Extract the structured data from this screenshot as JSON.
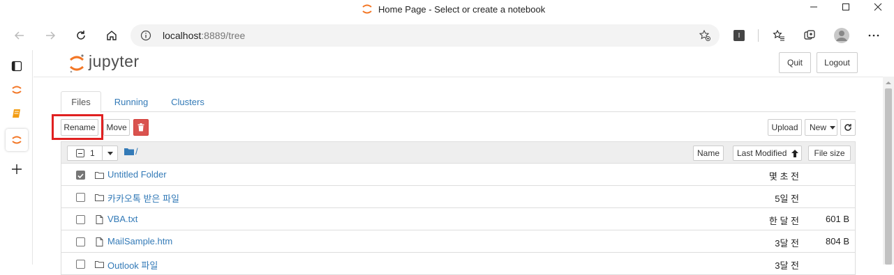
{
  "window": {
    "title": "Home Page - Select or create a notebook"
  },
  "browser": {
    "url_host": "localhost",
    "url_rest": ":8889/tree"
  },
  "jupyter": {
    "logo_text": "jupyter",
    "quit_label": "Quit",
    "logout_label": "Logout",
    "tabs": [
      {
        "label": "Files",
        "active": true
      },
      {
        "label": "Running",
        "active": false
      },
      {
        "label": "Clusters",
        "active": false
      }
    ],
    "toolbar": {
      "rename_label": "Rename",
      "move_label": "Move",
      "upload_label": "Upload",
      "new_label": "New"
    },
    "list_header": {
      "selected_count": "1",
      "path": "/",
      "name_label": "Name",
      "last_modified_label": "Last Modified",
      "file_size_label": "File size"
    },
    "items": [
      {
        "name": "Untitled Folder",
        "type": "folder",
        "modified": "몇 초 전",
        "size": "",
        "checked": true
      },
      {
        "name": "카카오톡 받은 파일",
        "type": "folder",
        "modified": "5일 전",
        "size": "",
        "checked": false
      },
      {
        "name": "VBA.txt",
        "type": "file",
        "modified": "한 달 전",
        "size": "601 B",
        "checked": false
      },
      {
        "name": "MailSample.htm",
        "type": "file",
        "modified": "3달 전",
        "size": "804 B",
        "checked": false
      },
      {
        "name": "Outlook 파일",
        "type": "folder",
        "modified": "3달 전",
        "size": "",
        "checked": false
      }
    ]
  },
  "colors": {
    "highlight": "#e02020",
    "link": "#337ab7",
    "delete": "#d9534f",
    "jupyter_orange": "#f37726"
  }
}
